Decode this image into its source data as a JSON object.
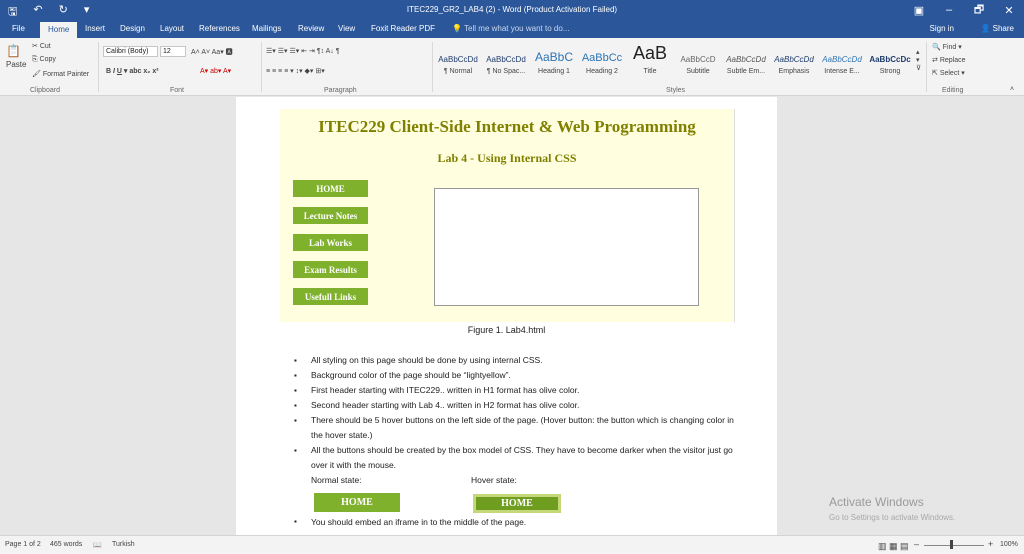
{
  "window": {
    "title": "ITEC229_GR2_LAB4 (2) - Word (Product Activation Failed)",
    "minimize": "–",
    "restore": "🗗",
    "close": "✕"
  },
  "tabs": [
    "File",
    "Home",
    "Insert",
    "Design",
    "Layout",
    "References",
    "Mailings",
    "Review",
    "View",
    "Foxit Reader PDF"
  ],
  "tell_me": "Tell me what you want to do...",
  "sign_in": "Sign in",
  "share": "Share",
  "ribbon": {
    "clipboard": {
      "cut": "Cut",
      "copy": "Copy",
      "paste": "Paste",
      "format_painter": "Format Painter",
      "label": "Clipboard"
    },
    "font": {
      "name": "Calibri (Body)",
      "size": "12",
      "label": "Font"
    },
    "paragraph": {
      "label": "Paragraph"
    },
    "styles": {
      "label": "Styles",
      "items": [
        {
          "preview": "AaBbCcDd",
          "name": "¶ Normal"
        },
        {
          "preview": "AaBbCcDd",
          "name": "¶ No Spac..."
        },
        {
          "preview": "AaBbC",
          "name": "Heading 1"
        },
        {
          "preview": "AaBbCc",
          "name": "Heading 2"
        },
        {
          "preview": "AaB",
          "name": "Title"
        },
        {
          "preview": "AaBbCcD",
          "name": "Subtitle"
        },
        {
          "preview": "AaBbCcDd",
          "name": "Subtle Em..."
        },
        {
          "preview": "AaBbCcDd",
          "name": "Emphasis"
        },
        {
          "preview": "AaBbCcDd",
          "name": "Intense E..."
        },
        {
          "preview": "AaBbCcDc",
          "name": "Strong"
        }
      ]
    },
    "editing": {
      "find": "Find",
      "replace": "Replace",
      "select": "Select",
      "label": "Editing"
    }
  },
  "document": {
    "h1": "ITEC229 Client-Side Internet & Web Programming",
    "h2": "Lab 4 - Using Internal CSS",
    "nav_buttons": [
      "HOME",
      "Lecture Notes",
      "Lab Works",
      "Exam Results",
      "Usefull Links"
    ],
    "caption": "Figure 1. Lab4.html",
    "bullets": [
      "All styling on this page should be done by using internal CSS.",
      "Background color of the page should be “lightyellow”.",
      "First header starting with ITEC229.. written in H1 format has olive color.",
      "Second header starting with Lab 4.. written in H2 format has olive color.",
      "There should be 5 hover buttons on the left side of the page. (Hover button: the button which is changing color in the hover state.)",
      "All the buttons should be created by the box model of CSS. They have to become darker when the visitor just go over it with the mouse."
    ],
    "normal_state": "Normal state:",
    "hover_state": "Hover state:",
    "demo_button": "HOME",
    "last_bullet": "You should embed an iframe in to the middle of the page."
  },
  "activate": {
    "title": "Activate Windows",
    "subtitle": "Go to Settings to activate Windows."
  },
  "status": {
    "page": "Page 1 of 2",
    "words": "465 words",
    "language": "Turkish",
    "zoom": "100%"
  },
  "colors": {
    "word_blue": "#2b579a",
    "page_bg": "#ffffe0",
    "olive": "#808000",
    "button_green": "#7fb12d",
    "hover_green": "#6e9d1f"
  }
}
